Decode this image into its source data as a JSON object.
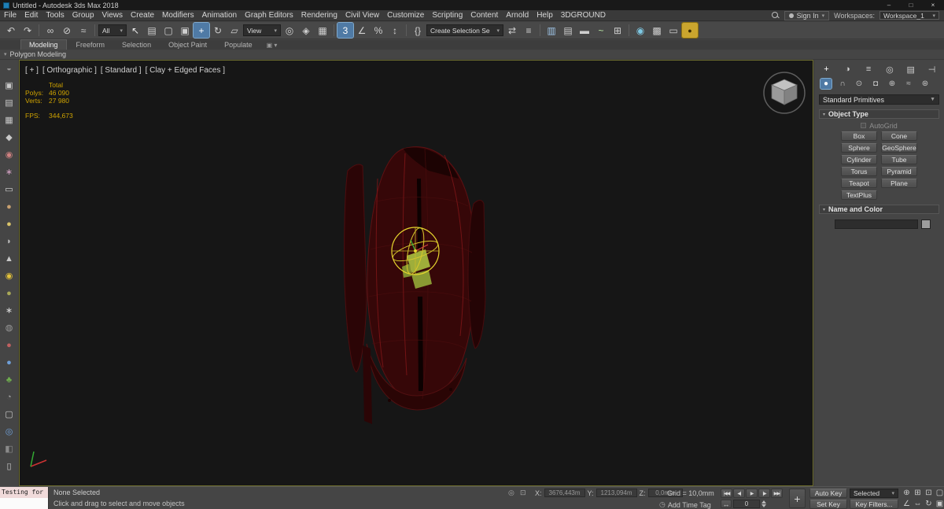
{
  "window": {
    "title": "Untitled - Autodesk 3ds Max 2018",
    "controls": [
      {
        "name": "minimize-button",
        "glyph": "–"
      },
      {
        "name": "maximize-button",
        "glyph": "□"
      },
      {
        "name": "close-button",
        "glyph": "×"
      }
    ]
  },
  "menu": {
    "items": [
      "File",
      "Edit",
      "Tools",
      "Group",
      "Views",
      "Create",
      "Modifiers",
      "Animation",
      "Graph Editors",
      "Rendering",
      "Civil View",
      "Customize",
      "Scripting",
      "Content",
      "Arnold",
      "Help",
      "3DGROUND"
    ],
    "sign_in": "Sign In",
    "workspaces_label": "Workspaces:",
    "workspace_value": "Workspace_1"
  },
  "toolbar": {
    "items": [
      {
        "kind": "icon",
        "name": "undo-button",
        "glyph": "↶",
        "color": "#cfcfcf"
      },
      {
        "kind": "icon",
        "name": "redo-button",
        "glyph": "↷",
        "color": "#cfcfcf"
      },
      {
        "kind": "sep"
      },
      {
        "kind": "icon",
        "name": "select-and-link-button",
        "glyph": "∞",
        "color": "#cfcfcf"
      },
      {
        "kind": "icon",
        "name": "unlink-selection-button",
        "glyph": "⊘",
        "color": "#cfcfcf"
      },
      {
        "kind": "icon",
        "name": "bind-to-space-warp-button",
        "glyph": "≈",
        "color": "#cfcfcf"
      },
      {
        "kind": "sep"
      },
      {
        "kind": "dropdown",
        "name": "selection-filter-dropdown",
        "label": "All",
        "w": 36
      },
      {
        "kind": "icon",
        "name": "select-object-button",
        "glyph": "↖",
        "color": "#ececec"
      },
      {
        "kind": "icon",
        "name": "select-by-name-button",
        "glyph": "▤",
        "color": "#cfcfcf"
      },
      {
        "kind": "icon",
        "name": "rectangular-selection-region-button",
        "glyph": "▢",
        "color": "#cfcfcf"
      },
      {
        "kind": "icon",
        "name": "window-crossing-toggle",
        "glyph": "▣",
        "color": "#cfcfcf"
      },
      {
        "kind": "icon",
        "name": "select-and-move-button",
        "glyph": "+",
        "color": "#ffffff",
        "active": true
      },
      {
        "kind": "icon",
        "name": "select-and-rotate-button",
        "glyph": "↻",
        "color": "#cfcfcf"
      },
      {
        "kind": "icon",
        "name": "select-and-scale-button",
        "glyph": "▱",
        "color": "#cfcfcf"
      },
      {
        "kind": "dropdown",
        "name": "reference-coordinate-system-dropdown",
        "label": "View",
        "w": 48
      },
      {
        "kind": "icon",
        "name": "use-pivot-point-center-button",
        "glyph": "◎",
        "color": "#cfcfcf"
      },
      {
        "kind": "icon",
        "name": "select-and-manipulate-button",
        "glyph": "◈",
        "color": "#cfcfcf"
      },
      {
        "kind": "icon",
        "name": "keyboard-shortcut-override-toggle",
        "glyph": "▦",
        "color": "#cfcfcf"
      },
      {
        "kind": "sep"
      },
      {
        "kind": "icon",
        "name": "snaps-toggle-3d",
        "glyph": "3",
        "color": "#ffffff",
        "active": true
      },
      {
        "kind": "icon",
        "name": "angle-snap-toggle",
        "glyph": "∠",
        "color": "#cfcfcf"
      },
      {
        "kind": "icon",
        "name": "percent-snap-toggle",
        "glyph": "%",
        "color": "#cfcfcf"
      },
      {
        "kind": "icon",
        "name": "spinner-snap-toggle",
        "glyph": "↕",
        "color": "#cfcfcf"
      },
      {
        "kind": "sep"
      },
      {
        "kind": "icon",
        "name": "edit-named-selection-sets-button",
        "glyph": "{}",
        "color": "#cfcfcf"
      },
      {
        "kind": "dropdown",
        "name": "named-selection-sets-dropdown",
        "label": "Create Selection Se",
        "w": 98
      },
      {
        "kind": "icon",
        "name": "mirror-button",
        "glyph": "⇄",
        "color": "#cfcfcf"
      },
      {
        "kind": "icon",
        "name": "align-button",
        "glyph": "≡",
        "color": "#cfcfcf"
      },
      {
        "kind": "sep"
      },
      {
        "kind": "icon",
        "name": "toggle-scene-explorer-button",
        "glyph": "▥",
        "color": "#9fc5e8"
      },
      {
        "kind": "icon",
        "name": "toggle-layer-explorer-button",
        "glyph": "▤",
        "color": "#cfcfcf"
      },
      {
        "kind": "icon",
        "name": "toggle-ribbon-button",
        "glyph": "▬",
        "color": "#cfcfcf"
      },
      {
        "kind": "icon",
        "name": "curve-editor-button",
        "glyph": "~",
        "color": "#b5e0a0"
      },
      {
        "kind": "icon",
        "name": "schematic-view-button",
        "glyph": "⊞",
        "color": "#cfcfcf"
      },
      {
        "kind": "sep"
      },
      {
        "kind": "icon",
        "name": "material-editor-button",
        "glyph": "◉",
        "color": "#7ec8e3"
      },
      {
        "kind": "icon",
        "name": "render-setup-button",
        "glyph": "▩",
        "color": "#cfcfcf"
      },
      {
        "kind": "icon",
        "name": "rendered-frame-window-button",
        "glyph": "▭",
        "color": "#cfcfcf"
      },
      {
        "kind": "icon",
        "name": "render-production-button",
        "glyph": "●",
        "color": "#3a2b00",
        "boxed": true
      }
    ]
  },
  "ribbon": {
    "tabs": [
      {
        "label": "Modeling",
        "active": true
      },
      {
        "label": "Freeform"
      },
      {
        "label": "Selection"
      },
      {
        "label": "Object Paint"
      },
      {
        "label": "Populate"
      }
    ],
    "panel_title": "Polygon Modeling"
  },
  "left_toolbar": {
    "items": [
      {
        "name": "left-toolbar-icon-1",
        "glyph": "◒",
        "color": "#8f8f8f"
      },
      {
        "name": "left-toolbar-icon-2",
        "glyph": "▣",
        "color": "#c9c9c9"
      },
      {
        "name": "left-toolbar-icon-3",
        "glyph": "▤",
        "color": "#c9c9c9"
      },
      {
        "name": "left-toolbar-icon-4",
        "glyph": "▦",
        "color": "#c9c9c9"
      },
      {
        "name": "left-toolbar-icon-5",
        "glyph": "◆",
        "color": "#c9c9c9"
      },
      {
        "name": "left-toolbar-icon-6",
        "glyph": "◉",
        "color": "#cf8080"
      },
      {
        "name": "left-toolbar-icon-7",
        "glyph": "∗",
        "color": "#d0a0c0"
      },
      {
        "name": "left-toolbar-icon-8",
        "glyph": "▭",
        "color": "#d8d8d8"
      },
      {
        "name": "left-toolbar-icon-9",
        "glyph": "●",
        "color": "#c8a070"
      },
      {
        "name": "left-toolbar-icon-10",
        "glyph": "●",
        "color": "#d9c36a"
      },
      {
        "name": "left-toolbar-icon-11",
        "glyph": "◗",
        "color": "#bcbcbc"
      },
      {
        "name": "left-toolbar-icon-12",
        "glyph": "▲",
        "color": "#c9c9c9"
      },
      {
        "name": "left-toolbar-icon-13",
        "glyph": "◉",
        "color": "#e3c23a"
      },
      {
        "name": "left-toolbar-icon-14",
        "glyph": "●",
        "color": "#a8a858"
      },
      {
        "name": "left-toolbar-icon-15",
        "glyph": "∗",
        "color": "#d8d8d8"
      },
      {
        "name": "left-toolbar-icon-16",
        "glyph": "◍",
        "color": "#9a9a9a"
      },
      {
        "name": "left-toolbar-icon-17",
        "glyph": "●",
        "color": "#c06060"
      },
      {
        "name": "left-toolbar-icon-18",
        "glyph": "●",
        "color": "#6f9fd8"
      },
      {
        "name": "left-toolbar-icon-19",
        "glyph": "♣",
        "color": "#6fae4e"
      },
      {
        "name": "left-toolbar-icon-20",
        "glyph": "◔",
        "color": "#9a9a9a"
      },
      {
        "name": "left-toolbar-icon-21",
        "glyph": "▢",
        "color": "#c9c9c9"
      },
      {
        "name": "left-toolbar-icon-22",
        "glyph": "◎",
        "color": "#6f9fd8"
      },
      {
        "name": "left-toolbar-icon-23",
        "glyph": "◧",
        "color": "#8a8a8a"
      },
      {
        "name": "left-toolbar-icon-24",
        "glyph": "▯",
        "color": "#c9c9c9"
      }
    ]
  },
  "viewport": {
    "label_parts": [
      "[ + ]",
      "[ Orthographic ]",
      "[ Standard ]",
      "[ Clay + Edged Faces ]"
    ],
    "stats": {
      "total_label": "Total",
      "polys_label": "Polys:",
      "polys_value": "46 090",
      "verts_label": "Verts:",
      "verts_value": "27 980",
      "fps_label": "FPS:",
      "fps_value": "344,673"
    }
  },
  "right_panel": {
    "command_tabs": [
      {
        "name": "create-tab",
        "glyph": "+",
        "active": true
      },
      {
        "name": "modify-tab",
        "glyph": "◑"
      },
      {
        "name": "hierarchy-tab",
        "glyph": "≡"
      },
      {
        "name": "motion-tab",
        "glyph": "◎"
      },
      {
        "name": "display-tab",
        "glyph": "▤"
      },
      {
        "name": "utilities-tab",
        "glyph": "⊣"
      }
    ],
    "category_tabs": [
      {
        "name": "geometry-category-tab",
        "glyph": "●",
        "active": true
      },
      {
        "name": "shapes-category-tab",
        "glyph": "∩"
      },
      {
        "name": "lights-category-tab",
        "glyph": "⊙"
      },
      {
        "name": "cameras-category-tab",
        "glyph": "◘"
      },
      {
        "name": "helpers-category-tab",
        "glyph": "⊕"
      },
      {
        "name": "space-warps-category-tab",
        "glyph": "≈"
      },
      {
        "name": "systems-category-tab",
        "glyph": "⊛"
      }
    ],
    "primitives_dropdown": "Standard Primitives",
    "object_type": {
      "title": "Object Type",
      "autogrid_label": "AutoGrid",
      "buttons": [
        "Box",
        "Cone",
        "Sphere",
        "GeoSphere",
        "Cylinder",
        "Tube",
        "Torus",
        "Pyramid",
        "Teapot",
        "Plane",
        "TextPlus"
      ]
    },
    "name_color": {
      "title": "Name and Color"
    }
  },
  "status_bar": {
    "listener_text": "Testing for ;",
    "selection_status": "None Selected",
    "prompt": "Click and drag to select and move objects",
    "coords": {
      "x_label": "X:",
      "x_value": "3676,443m",
      "y_label": "Y:",
      "y_value": "1213,094m",
      "z_label": "Z:",
      "z_value": "0,0mm"
    },
    "grid_label": "Grid = 10,0mm",
    "add_time_tag": "Add Time Tag",
    "playback": [
      {
        "name": "go-to-start-button",
        "glyph": "|◀◀"
      },
      {
        "name": "previous-frame-button",
        "glyph": "◀|"
      },
      {
        "name": "play-animation-button",
        "glyph": "▶"
      },
      {
        "name": "next-frame-button",
        "glyph": "|▶"
      },
      {
        "name": "go-to-end-button",
        "glyph": "▶▶|"
      }
    ],
    "key_mode_glyph": "↔",
    "frame_value": "0",
    "set_keys_glyph": "+",
    "auto_key": "Auto Key",
    "selected_dropdown": "Selected",
    "set_key": "Set Key",
    "key_filters": "Key Filters...",
    "nav_icons": [
      {
        "name": "zoom-icon",
        "glyph": "⊕"
      },
      {
        "name": "zoom-all-icon",
        "glyph": "⊞"
      },
      {
        "name": "zoom-extents-icon",
        "glyph": "⊡"
      },
      {
        "name": "zoom-region-icon",
        "glyph": "▢"
      },
      {
        "name": "field-of-view-icon",
        "glyph": "∠"
      },
      {
        "name": "pan-icon",
        "glyph": "⇔"
      },
      {
        "name": "orbit-icon",
        "glyph": "↻"
      },
      {
        "name": "maximize-viewport-toggle",
        "glyph": "▣"
      }
    ]
  }
}
